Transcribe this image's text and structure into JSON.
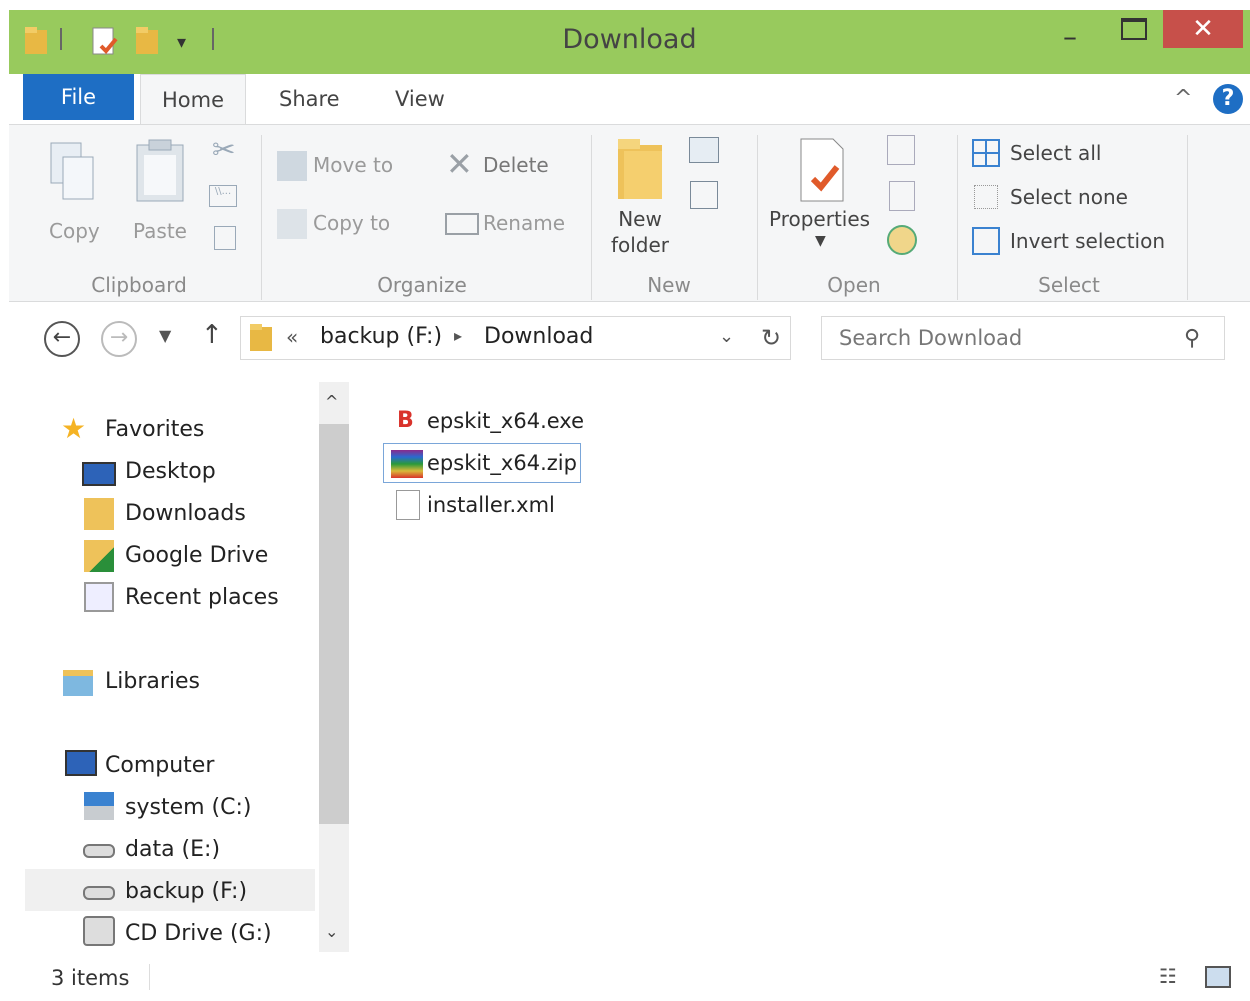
{
  "window": {
    "title": "Download",
    "close_glyph": "✕",
    "minimize_glyph": "–",
    "maximize_glyph": "☐",
    "help_glyph": "?",
    "collapse_glyph": "^"
  },
  "tabs": {
    "file": "File",
    "home": "Home",
    "share": "Share",
    "view": "View"
  },
  "ribbon": {
    "clipboard": {
      "copy": "Copy",
      "paste": "Paste",
      "group": "Clipboard"
    },
    "organize": {
      "move_to": "Move to",
      "copy_to": "Copy to",
      "delete": "Delete",
      "rename": "Rename",
      "group": "Organize"
    },
    "new": {
      "new_folder_1": "New",
      "new_folder_2": "folder",
      "group": "New"
    },
    "open": {
      "properties": "Properties",
      "group": "Open"
    },
    "select": {
      "select_all": "Select all",
      "select_none": "Select none",
      "invert": "Invert selection",
      "group": "Select"
    }
  },
  "address": {
    "overflow": "«",
    "drive": "backup (F:)",
    "sep": "▸",
    "folder": "Download"
  },
  "search": {
    "placeholder": "Search Download"
  },
  "nav": {
    "favorites": "Favorites",
    "desktop": "Desktop",
    "downloads": "Downloads",
    "gdrive": "Google Drive",
    "recent": "Recent places",
    "libraries": "Libraries",
    "computer": "Computer",
    "system": "system (C:)",
    "data": "data (E:)",
    "backup": "backup (F:)",
    "cd": "CD Drive (G:)"
  },
  "files": [
    {
      "name": "epskit_x64.exe"
    },
    {
      "name": "epskit_x64.zip"
    },
    {
      "name": "installer.xml"
    }
  ],
  "status": {
    "count": "3 items"
  },
  "colors": {
    "titlebar": "#98ca5d",
    "close": "#c7504a",
    "file_tab": "#1e6ec4",
    "ribbon": "#f5f6f7",
    "selected_nav": "#f0f0f0",
    "help": "#1e6ec4"
  }
}
